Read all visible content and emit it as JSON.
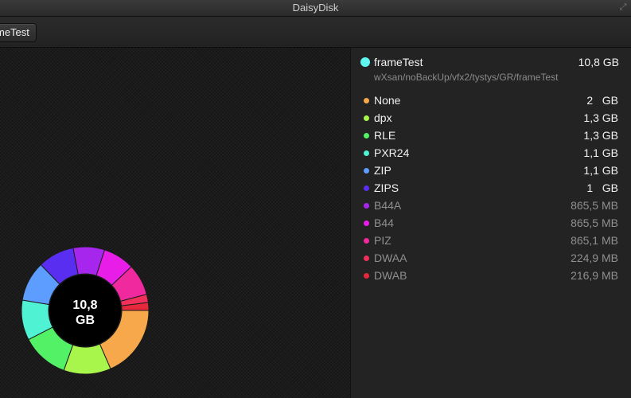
{
  "window": {
    "title": "DaisyDisk"
  },
  "toolbar": {
    "crumb_label": "meTest"
  },
  "folder": {
    "name": "frameTest",
    "size": "10,8 GB",
    "path": "wXsan/noBackUp/vfx2/tystys/GR/frameTest",
    "color": "#5ff6f0"
  },
  "items": [
    {
      "name": "None",
      "size": "2   GB",
      "color": "#f6a84b",
      "dim": false
    },
    {
      "name": "dpx",
      "size": "1,3 GB",
      "color": "#a8f54b",
      "dim": false
    },
    {
      "name": "RLE",
      "size": "1,3 GB",
      "color": "#53f166",
      "dim": false
    },
    {
      "name": "PXR24",
      "size": "1,1 GB",
      "color": "#4ff2d2",
      "dim": false
    },
    {
      "name": "ZIP",
      "size": "1,1 GB",
      "color": "#5c9dff",
      "dim": false
    },
    {
      "name": "ZIPS",
      "size": "1   GB",
      "color": "#5a2ef0",
      "dim": false
    },
    {
      "name": "B44A",
      "size": "865,5 MB",
      "color": "#a726ee",
      "dim": true
    },
    {
      "name": "B44",
      "size": "865,5 MB",
      "color": "#e81ee8",
      "dim": true
    },
    {
      "name": "PIZ",
      "size": "865,1 MB",
      "color": "#f0299e",
      "dim": true
    },
    {
      "name": "DWAA",
      "size": "224,9 MB",
      "color": "#f0305a",
      "dim": true
    },
    {
      "name": "DWAB",
      "size": "216,9 MB",
      "color": "#e5283b",
      "dim": true
    }
  ],
  "chart_data": {
    "type": "pie",
    "center_label": [
      "10,8",
      "GB"
    ],
    "categories": [
      "None",
      "dpx",
      "RLE",
      "PXR24",
      "ZIP",
      "ZIPS",
      "B44A",
      "B44",
      "PIZ",
      "DWAA",
      "DWAB"
    ],
    "values_gb": [
      2.0,
      1.3,
      1.3,
      1.1,
      1.1,
      1.0,
      0.8655,
      0.8655,
      0.8651,
      0.2249,
      0.2169
    ],
    "colors": [
      "#f6a84b",
      "#a8f54b",
      "#53f166",
      "#4ff2d2",
      "#5c9dff",
      "#5a2ef0",
      "#a726ee",
      "#e81ee8",
      "#f0299e",
      "#f0305a",
      "#e5283b"
    ]
  }
}
